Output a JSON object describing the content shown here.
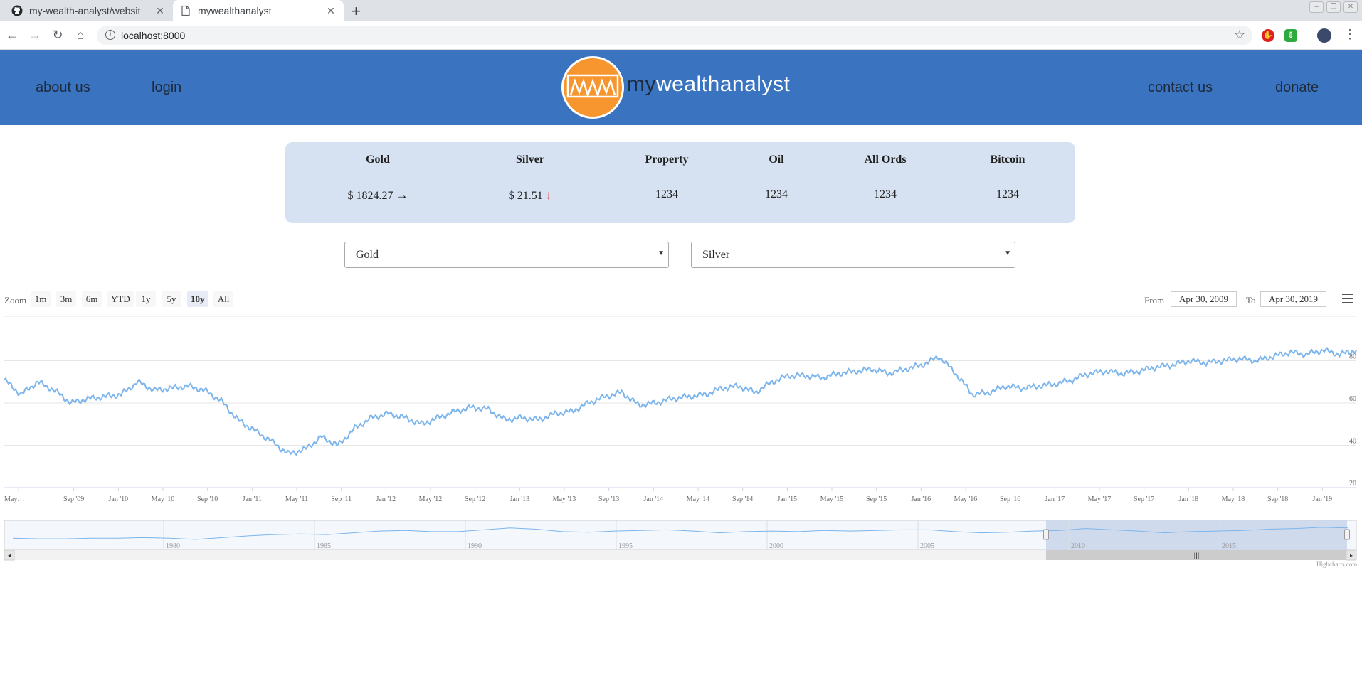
{
  "browser": {
    "tabs": [
      {
        "title": "my-wealth-analyst/websit",
        "active": false
      },
      {
        "title": "mywealthanalyst",
        "active": true
      }
    ],
    "url": "localhost:8000"
  },
  "site": {
    "nav_left": [
      "about us",
      "login"
    ],
    "nav_right": [
      "contact us",
      "donate"
    ],
    "brand_my": "my",
    "brand_rest": "wealthanalyst",
    "logo_text": "MWA"
  },
  "ticker": [
    {
      "name": "Gold",
      "value": "$ 1824.27",
      "trend": "flat"
    },
    {
      "name": "Silver",
      "value": "$ 21.51",
      "trend": "down"
    },
    {
      "name": "Property",
      "value": "1234",
      "trend": ""
    },
    {
      "name": "Oil",
      "value": "1234",
      "trend": ""
    },
    {
      "name": "All Ords",
      "value": "1234",
      "trend": ""
    },
    {
      "name": "Bitcoin",
      "value": "1234",
      "trend": ""
    }
  ],
  "selects": {
    "left": "Gold",
    "right": "Silver"
  },
  "range_selector": {
    "zoom_label": "Zoom",
    "buttons": [
      "1m",
      "3m",
      "6m",
      "YTD",
      "1y",
      "5y",
      "10y",
      "All"
    ],
    "selected": "10y",
    "from_label": "From",
    "from_value": "Apr 30, 2009",
    "to_label": "To",
    "to_value": "Apr 30, 2019"
  },
  "colors": {
    "header": "#3a74c0",
    "accent": "#f7962f",
    "series": "#7cb5ec",
    "down": "#e02020"
  },
  "credit": "Highcharts.com",
  "chart_data": {
    "type": "line",
    "title": "",
    "x_tick_labels": [
      "May…",
      "Sep '09",
      "Jan '10",
      "May '10",
      "Sep '10",
      "Jan '11",
      "May '11",
      "Sep '11",
      "Jan '12",
      "May '12",
      "Sep '12",
      "Jan '13",
      "May '13",
      "Sep '13",
      "Jan '14",
      "May '14",
      "Sep '14",
      "Jan '15",
      "May '15",
      "Sep '15",
      "Jan '16",
      "May '16",
      "Sep '16",
      "Jan '17",
      "May '17",
      "Sep '17",
      "Jan '18",
      "May '18",
      "Sep '18",
      "Jan '19"
    ],
    "y_ticks": [
      20,
      40,
      60,
      80
    ],
    "ylim": [
      20,
      100
    ],
    "series": [
      {
        "values": [
          71,
          64,
          70,
          66,
          60,
          62,
          63,
          64,
          70,
          66,
          67,
          68,
          66,
          61,
          52,
          47,
          42,
          36,
          38,
          44,
          40,
          48,
          53,
          55,
          53,
          50,
          53,
          56,
          58,
          57,
          52,
          53,
          52,
          55,
          56,
          60,
          63,
          65,
          59,
          60,
          62,
          63,
          64,
          67,
          68,
          65,
          70,
          73,
          73,
          72,
          74,
          75,
          76,
          74,
          76,
          78,
          82,
          74,
          64,
          65,
          68,
          67,
          68,
          69,
          71,
          74,
          75,
          74,
          75,
          77,
          78,
          80,
          79,
          80,
          81,
          80,
          82,
          84,
          83,
          85,
          83,
          85
        ]
      }
    ],
    "navigator": {
      "x_tick_labels": [
        "1980",
        "1985",
        "1990",
        "1995",
        "2000",
        "2005",
        "2010",
        "2015"
      ],
      "values": [
        15,
        14,
        14,
        15,
        15,
        16,
        15,
        13,
        16,
        19,
        21,
        22,
        21,
        24,
        27,
        28,
        26,
        26,
        29,
        32,
        30,
        26,
        25,
        27,
        28,
        29,
        27,
        24,
        26,
        27,
        26,
        28,
        27,
        28,
        29,
        29,
        26,
        24,
        25,
        27,
        28,
        31,
        29,
        27,
        24,
        26,
        27,
        28,
        30,
        31,
        33,
        32
      ]
    }
  }
}
